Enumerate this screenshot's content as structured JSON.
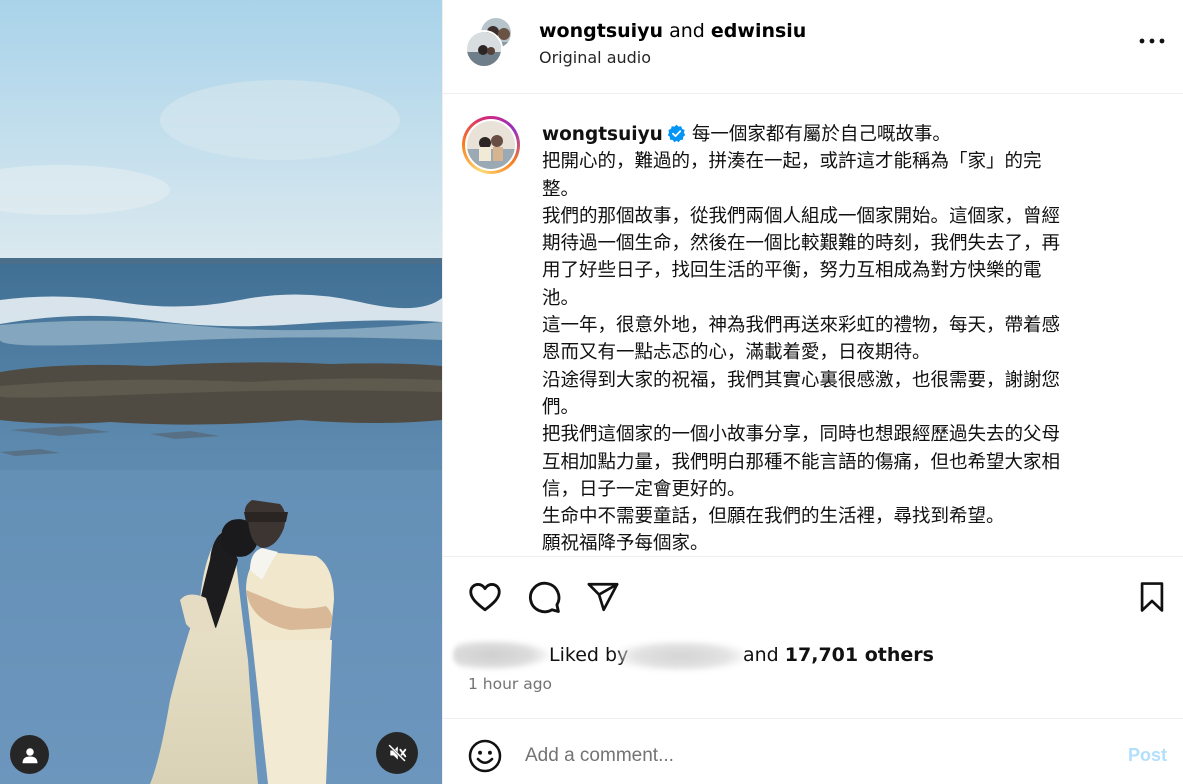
{
  "header": {
    "user1": "wongtsuiyu",
    "joiner": " and ",
    "user2": "edwinsiu",
    "audio_label": "Original audio",
    "more_icon": "more-horizontal-icon"
  },
  "caption": {
    "username": "wongtsuiyu",
    "verified_icon": "verified-badge-icon",
    "lines": [
      "每一個家都有屬於自己嘅故事。",
      "把開心的，難過的，拼湊在一起，或許這才能稱為「家」的完",
      "整。",
      "我們的那個故事，從我們兩個人組成一個家開始。這個家，曾經",
      "期待過一個生命，然後在一個比較艱難的時刻，我們失去了，再",
      "用了好些日子，找回生活的平衡，努力互相成為對方快樂的電",
      "池。",
      "這一年，很意外地，神為我們再送來彩虹的禮物，每天，帶着感",
      "恩而又有一點忐忑的心，滿載着愛，日夜期待。",
      "沿途得到大家的祝福，我們其實心裏很感激，也很需要，謝謝您",
      "們。",
      "把我們這個家的一個小故事分享，同時也想跟經歷過失去的父母",
      "互相加點力量，我們明白那種不能言語的傷痛，但也希望大家相",
      "信，日子一定會更好的。",
      "生命中不需要童話，但願在我們的生活裡，尋找到希望。",
      "願祝福降予每個家。"
    ]
  },
  "actions": {
    "like_icon": "heart-icon",
    "comment_icon": "comment-icon",
    "share_icon": "share-icon",
    "save_icon": "bookmark-icon"
  },
  "likes": {
    "liked_by": "Liked by",
    "and_text": "and ",
    "others_count": "17,701 others"
  },
  "time_ago": "1 hour ago",
  "comment": {
    "emoji_icon": "emoji-icon",
    "placeholder": "Add a comment...",
    "post_label": "Post"
  },
  "media": {
    "user_tag_icon": "user-tag-icon",
    "mute_icon": "speaker-muted-icon"
  },
  "colors": {
    "post_disabled": "#b2dffc",
    "verified_blue": "#0095f6",
    "secondary_text": "#737373"
  }
}
